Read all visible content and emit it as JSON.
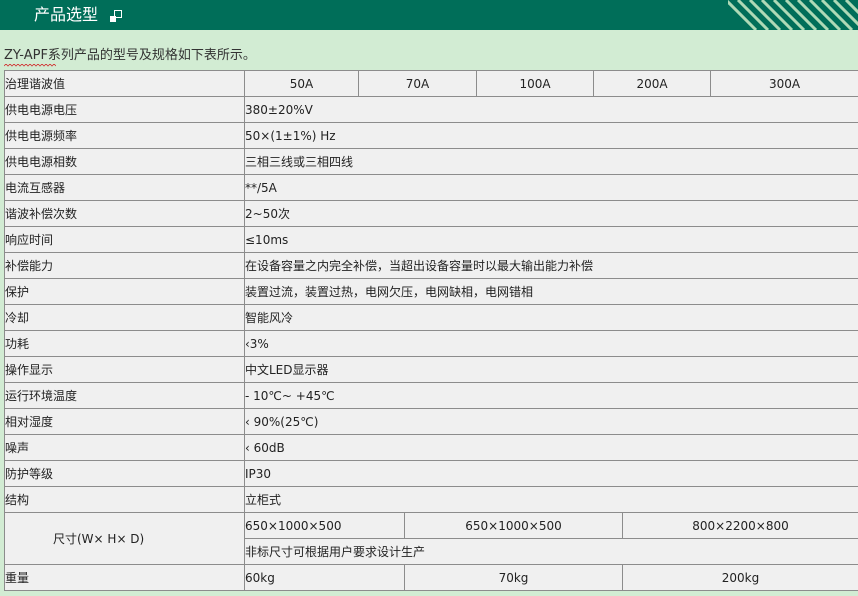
{
  "header": {
    "title": "产品选型",
    "mark_icon": "square-corner-icon",
    "bg_color": "#006e59",
    "stripe_color": "#aed9b6"
  },
  "intro": "ZY-APF系列产品的型号及规格如下表所示。",
  "table": {
    "header_label": "治理谐波值",
    "header_values": [
      "50A",
      "70A",
      "100A",
      "200A",
      "300A"
    ],
    "rows": [
      {
        "label": "供电电源电压",
        "value": "380±20%V"
      },
      {
        "label": "供电电源频率",
        "value": "50×(1±1%) Hz"
      },
      {
        "label": "供电电源相数",
        "value": "三相三线或三相四线"
      },
      {
        "label": "电流互感器",
        "value": "**/5A"
      },
      {
        "label": "谐波补偿次数",
        "value": "2~50次"
      },
      {
        "label": "响应时间",
        "value": "≤10ms"
      },
      {
        "label": "补偿能力",
        "value": "在设备容量之内完全补偿，当超出设备容量时以最大输出能力补偿"
      },
      {
        "label": "保护",
        "value": "装置过流，装置过热，电网欠压，电网缺相，电网错相"
      },
      {
        "label": "冷却",
        "value": "智能风冷"
      },
      {
        "label": "功耗",
        "value": "‹3%"
      },
      {
        "label": "操作显示",
        "value": "中文LED显示器"
      },
      {
        "label": "运行环境温度",
        "value": "- 10℃~ +45℃"
      },
      {
        "label": "相对湿度",
        "value": "‹ 90%(25℃)"
      },
      {
        "label": "噪声",
        "value": "‹ 60dB"
      },
      {
        "label": "防护等级",
        "value": "IP30"
      },
      {
        "label": "结构",
        "value": "立柜式"
      }
    ],
    "size": {
      "label": "尺寸(W× H× D)",
      "values": [
        "650×1000×500",
        "650×1000×500",
        "800×2200×800"
      ],
      "note": "非标尺寸可根据用户要求设计生产"
    },
    "weight": {
      "label": "重量",
      "values": [
        "60kg",
        "70kg",
        "200kg"
      ]
    }
  }
}
